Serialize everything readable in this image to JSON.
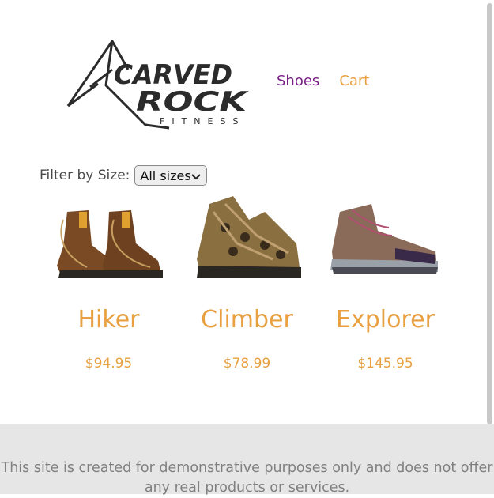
{
  "brand": {
    "line1": "CARVED",
    "line2": "ROCK",
    "line3": "FITNESS"
  },
  "nav": {
    "shoes": "Shoes",
    "cart": "Cart"
  },
  "filter": {
    "label": "Filter by Size:",
    "selected": "All sizes"
  },
  "products": [
    {
      "name": "Hiker",
      "price": "$94.95"
    },
    {
      "name": "Climber",
      "price": "$78.99"
    },
    {
      "name": "Explorer",
      "price": "$145.95"
    }
  ],
  "footer": {
    "text": "This site is created for demonstrative purposes only and does not offer any real products or services."
  },
  "colors": {
    "accent": "#e8a040",
    "link_visited": "#7a1f86",
    "footer_bg": "#e6e6e6"
  }
}
